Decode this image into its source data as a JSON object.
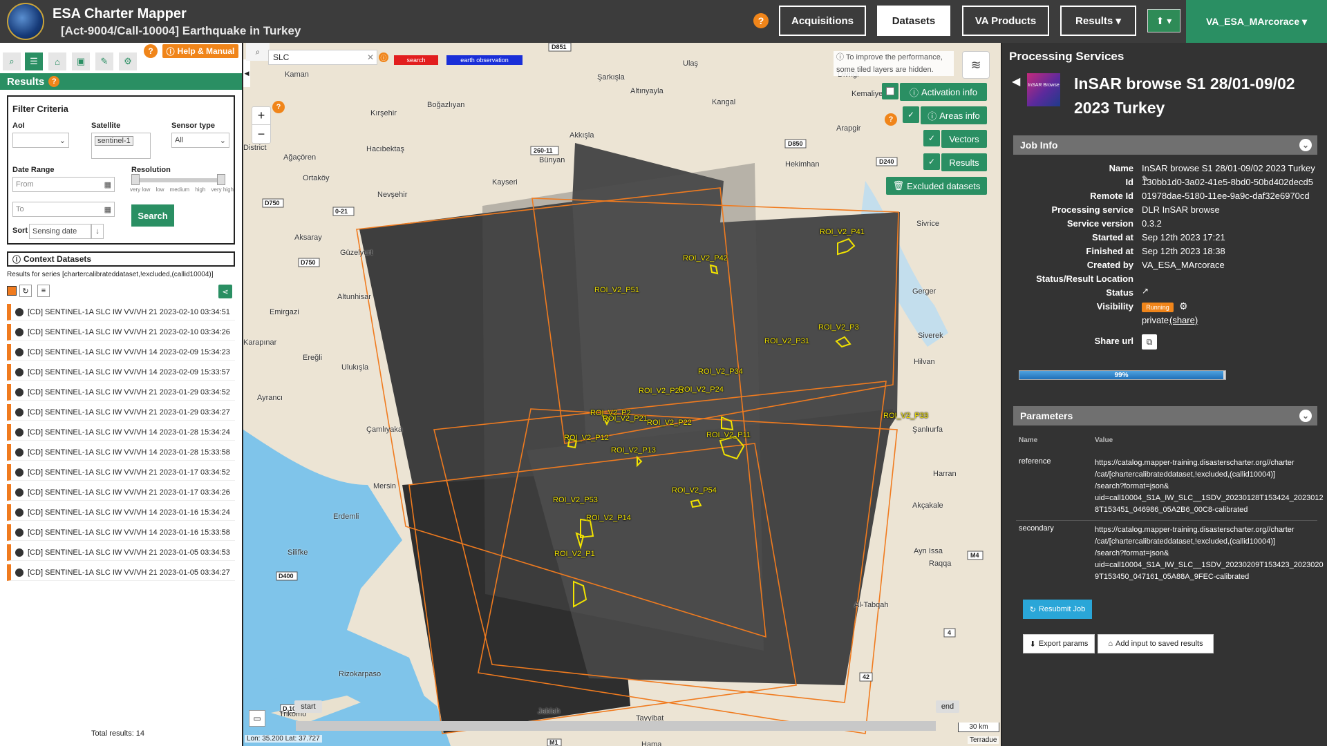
{
  "header": {
    "app_title": "ESA Charter Mapper",
    "subtitle": "[Act-9004/Call-10004] Earthquake in Turkey",
    "help": "?",
    "nav": [
      "Acquisitions",
      "Datasets",
      "VA Products",
      "Results ▾"
    ],
    "upload": "⬆ ▾",
    "user": "VA_ESA_MArcorace ▾"
  },
  "left": {
    "help_manual": "Help & Manual",
    "results_title": "Results",
    "filter": {
      "title": "Filter Criteria",
      "aoi_label": "AoI",
      "satellite_label": "Satellite",
      "satellite_chip": "sentinel-1",
      "sensor_label": "Sensor type",
      "sensor_value": "All",
      "date_label": "Date Range",
      "from_placeholder": "From",
      "to_placeholder": "To",
      "resolution_label": "Resolution",
      "res_ticks": [
        "very low",
        "low",
        "medium",
        "high",
        "very high"
      ],
      "sort_label": "Sort",
      "sort_value": "Sensing date",
      "search_button": "Search"
    },
    "context_title": "Context Datasets",
    "series_text": "Results for series [chartercalibrateddataset,!excluded,(callid10004)]",
    "rows": [
      "[CD] SENTINEL-1A SLC IW VV/VH 21 2023-02-10 03:34:51",
      "[CD] SENTINEL-1A SLC IW VV/VH 21 2023-02-10 03:34:26",
      "[CD] SENTINEL-1A SLC IW VV/VH 14 2023-02-09 15:34:23",
      "[CD] SENTINEL-1A SLC IW VV/VH 14 2023-02-09 15:33:57",
      "[CD] SENTINEL-1A SLC IW VV/VH 21 2023-01-29 03:34:52",
      "[CD] SENTINEL-1A SLC IW VV/VH 21 2023-01-29 03:34:27",
      "[CD] SENTINEL-1A SLC IW VV/VH 14 2023-01-28 15:34:24",
      "[CD] SENTINEL-1A SLC IW VV/VH 14 2023-01-28 15:33:58",
      "[CD] SENTINEL-1A SLC IW VV/VH 21 2023-01-17 03:34:52",
      "[CD] SENTINEL-1A SLC IW VV/VH 21 2023-01-17 03:34:26",
      "[CD] SENTINEL-1A SLC IW VV/VH 14 2023-01-16 15:34:24",
      "[CD] SENTINEL-1A SLC IW VV/VH 14 2023-01-16 15:33:58",
      "[CD] SENTINEL-1A SLC IW VV/VH 21 2023-01-05 03:34:53",
      "[CD] SENTINEL-1A SLC IW VV/VH 21 2023-01-05 03:34:27"
    ],
    "total": "Total results: 14"
  },
  "map": {
    "search_value": "SLC",
    "tag_search": "search",
    "tag_eo": "earth observation",
    "perf_notice": "To improve the performance, some tiled layers are hidden.",
    "toggles": [
      "Activation info",
      "Areas info",
      "Vectors",
      "Results",
      "Excluded datasets"
    ],
    "places": [
      "Kaman",
      "Kırşehir",
      "Boğazlıyan",
      "Şarkışla",
      "Ulaş",
      "Altınyayla",
      "Kangal",
      "Divriği",
      "Kemaliye",
      "Arapgir",
      "Hacıbektaş",
      "Ağaçören",
      "Akkışla",
      "Bünyan",
      "Kayseri",
      "Hekimhan",
      "Ortaköy",
      "Nevşehir",
      "Aksaray",
      "Güzelyurt",
      "Altunhisar",
      "Emirgazi",
      "Ereğli",
      "Ulukışla",
      "Çamlıyaka",
      "Ayrancı",
      "Karapınar",
      "Mersin",
      "Erdemli",
      "Silifke",
      "Rizokarpaso",
      "Trikomo",
      "Sivrice",
      "Gerger",
      "Siverek",
      "Hilvan",
      "Şanlıurfa",
      "Harran",
      "Akçakale",
      "Ayn Issa",
      "Raqqa",
      "Al-Tabqah",
      "Jablah",
      "Tayyibat",
      "Hama",
      "District"
    ],
    "roads": [
      "D851",
      "260-11",
      "D850",
      "D240",
      "D750",
      "0-21",
      "D750",
      "D400",
      "M4",
      "4",
      "42",
      "M1",
      "D.10"
    ],
    "rois": [
      "ROI_V2_P41",
      "ROI_V2_P42",
      "ROI_V2_P51",
      "ROI_V2_P3",
      "ROI_V2_P31",
      "ROI_V2_P34",
      "ROI_V2_P23",
      "ROI_V2_P24",
      "ROI_V2_P2",
      "ROI_V2_P21",
      "ROI_V2_P22",
      "ROI_V2_P33",
      "ROI_V2_P12",
      "ROI_V2_P13",
      "ROI_V2_P11",
      "ROI_V2_P54",
      "ROI_V2_P53",
      "ROI_V2_P14",
      "ROI_V2_P1"
    ],
    "timeline_start": "start",
    "timeline_end": "end",
    "scale": "30 km",
    "coords": "Lon: 35.200 Lat: 37.727",
    "attribution": "Terradue"
  },
  "right": {
    "title": "Processing Services",
    "job_title": "InSAR browse S1 28/01-09/02 2023 Turkey",
    "thumb_text": "InSAR Browse",
    "job_info_title": "Job Info",
    "info": [
      {
        "k": "Name",
        "v": "InSAR browse S1 28/01-09/02 2023 Turkey"
      },
      {
        "k": "Id",
        "v": "130bb1d0-3a02-41e5-8bd0-50bd402decd5"
      },
      {
        "k": "Remote Id",
        "v": "01978dae-5180-11ee-9a9c-daf32e6970cd"
      },
      {
        "k": "Processing service",
        "v": "DLR InSAR browse"
      },
      {
        "k": "Service version",
        "v": "0.3.2"
      },
      {
        "k": "Started at",
        "v": "Sep 12th 2023 17:21"
      },
      {
        "k": "Finished at",
        "v": "Sep 12th 2023 18:38"
      },
      {
        "k": "Created by",
        "v": "VA_ESA_MArcorace"
      },
      {
        "k": "Status/Result Location",
        "v": ""
      },
      {
        "k": "Status",
        "v": "Running"
      },
      {
        "k": "Visibility",
        "v": "private"
      }
    ],
    "share_link": "(share)",
    "share_url_label": "Share url",
    "progress": 0.99,
    "progress_label": "99%",
    "params_title": "Parameters",
    "param_head_name": "Name",
    "param_head_value": "Value",
    "params": [
      {
        "name": "reference",
        "lines": [
          "https://catalog.mapper-training.disasterscharter.org//charter",
          "/cat/[chartercalibrateddataset,!excluded,(callid10004)]",
          "/search?format=json&",
          "uid=call10004_S1A_IW_SLC__1SDV_20230128T153424_2023012",
          "8T153451_046986_05A2B6_00C8-calibrated"
        ]
      },
      {
        "name": "secondary",
        "lines": [
          "https://catalog.mapper-training.disasterscharter.org//charter",
          "/cat/[chartercalibrateddataset,!excluded,(callid10004)]",
          "/search?format=json&",
          "uid=call10004_S1A_IW_SLC__1SDV_20230209T153423_2023020",
          "9T153450_047161_05A88A_9FEC-calibrated"
        ]
      }
    ],
    "resubmit": "Resubmit Job",
    "export": "Export params",
    "add_input": "Add input to saved results"
  }
}
